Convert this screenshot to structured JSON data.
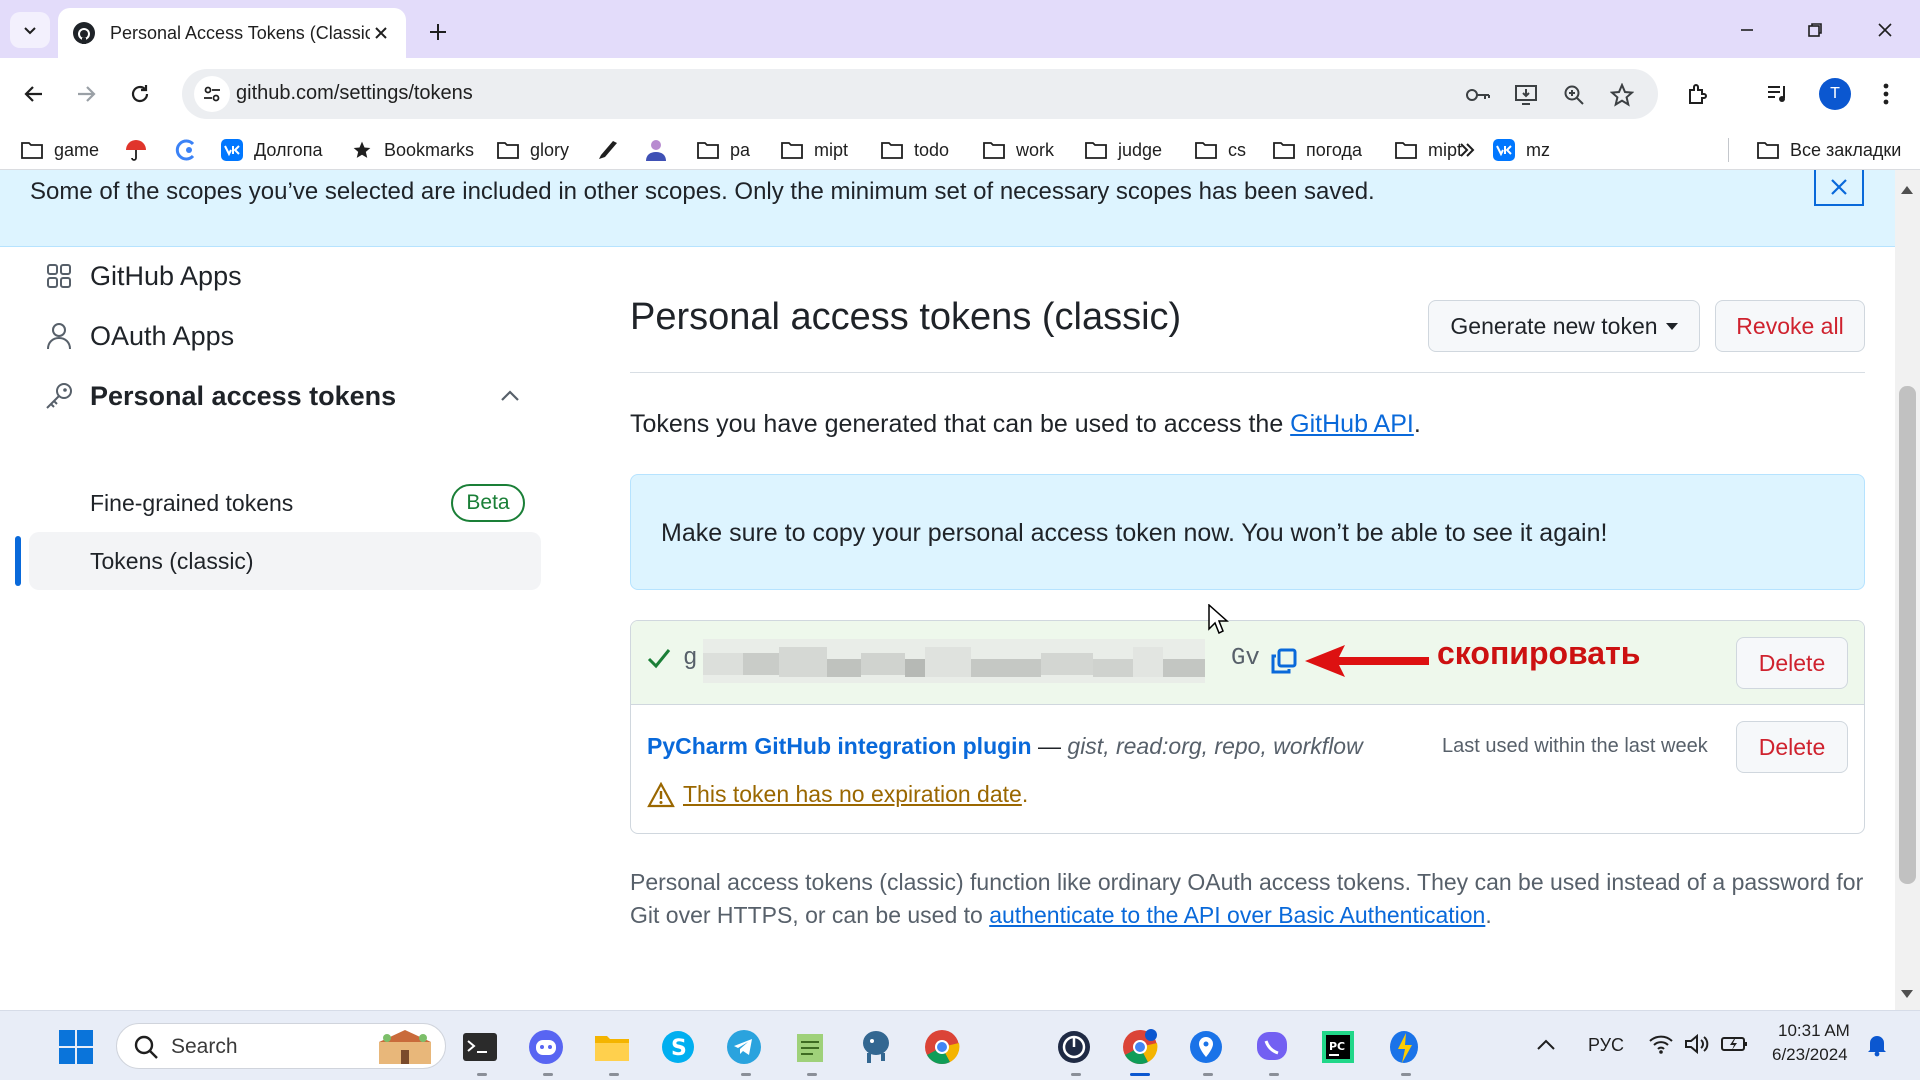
{
  "browser": {
    "tab_title": "Personal Access Tokens (Classic)",
    "url": "github.com/settings/tokens",
    "profile_initial": "T",
    "bookmarks": [
      {
        "label": "game",
        "icon": "folder-icon"
      },
      {
        "label": "",
        "icon": "umbrella-icon"
      },
      {
        "label": "",
        "icon": "swirl-icon"
      },
      {
        "label": "Долгопа",
        "icon": "vk-icon"
      },
      {
        "label": "Bookmarks",
        "icon": "star-icon"
      },
      {
        "label": "glory",
        "icon": "folder-icon"
      },
      {
        "label": "",
        "icon": "pen-icon"
      },
      {
        "label": "",
        "icon": "person-icon"
      },
      {
        "label": "pa",
        "icon": "folder-icon"
      },
      {
        "label": "mipt",
        "icon": "folder-icon"
      },
      {
        "label": "todo",
        "icon": "folder-icon"
      },
      {
        "label": "work",
        "icon": "folder-icon"
      },
      {
        "label": "judge",
        "icon": "folder-icon"
      },
      {
        "label": "cs",
        "icon": "folder-icon"
      },
      {
        "label": "погода",
        "icon": "folder-icon"
      },
      {
        "label": "mipt",
        "icon": "folder-icon"
      },
      {
        "label": "mz",
        "icon": "vk-icon"
      }
    ],
    "all_bookmarks": "Все закладки"
  },
  "flash": {
    "text": "Some of the scopes you’ve selected are included in other scopes. Only the minimum set of necessary scopes has been saved."
  },
  "sidebar": {
    "github_apps": "GitHub Apps",
    "oauth_apps": "OAuth Apps",
    "pat": "Personal access tokens",
    "fine_grained": "Fine-grained tokens",
    "beta": "Beta",
    "classic": "Tokens (classic)"
  },
  "main": {
    "title": "Personal access tokens (classic)",
    "generate_btn": "Generate new token",
    "revoke_btn": "Revoke all",
    "intro_prefix": "Tokens you have generated that can be used to access the ",
    "intro_link": "GitHub API",
    "intro_suffix": ".",
    "notice": "Make sure to copy your personal access token now. You won’t be able to see it again!",
    "token_prefix": "g",
    "token_suffix": "Gv",
    "annotation": "скопировать",
    "delete_label": "Delete",
    "token_name": "PyCharm GitHub integration plugin",
    "token_dash": " — ",
    "token_scopes": "gist, read:org, repo, workflow",
    "last_used": "Last used within the last week",
    "warning": "This token has no expiration date",
    "warning_suffix": ".",
    "footer_text": "Personal access tokens (classic) function like ordinary OAuth access tokens. They can be used instead of a password for Git over HTTPS, or can be used to ",
    "footer_link": "authenticate to the API over Basic Authentication",
    "footer_suffix": "."
  },
  "taskbar": {
    "search": "Search",
    "lang": "РУС",
    "time": "10:31 AM",
    "date": "6/23/2024"
  },
  "colors": {
    "accent": "#0969da",
    "danger": "#cf222e",
    "success": "#1a7f37",
    "warning": "#9a6700",
    "tabstrip": "#e3dcfa"
  }
}
